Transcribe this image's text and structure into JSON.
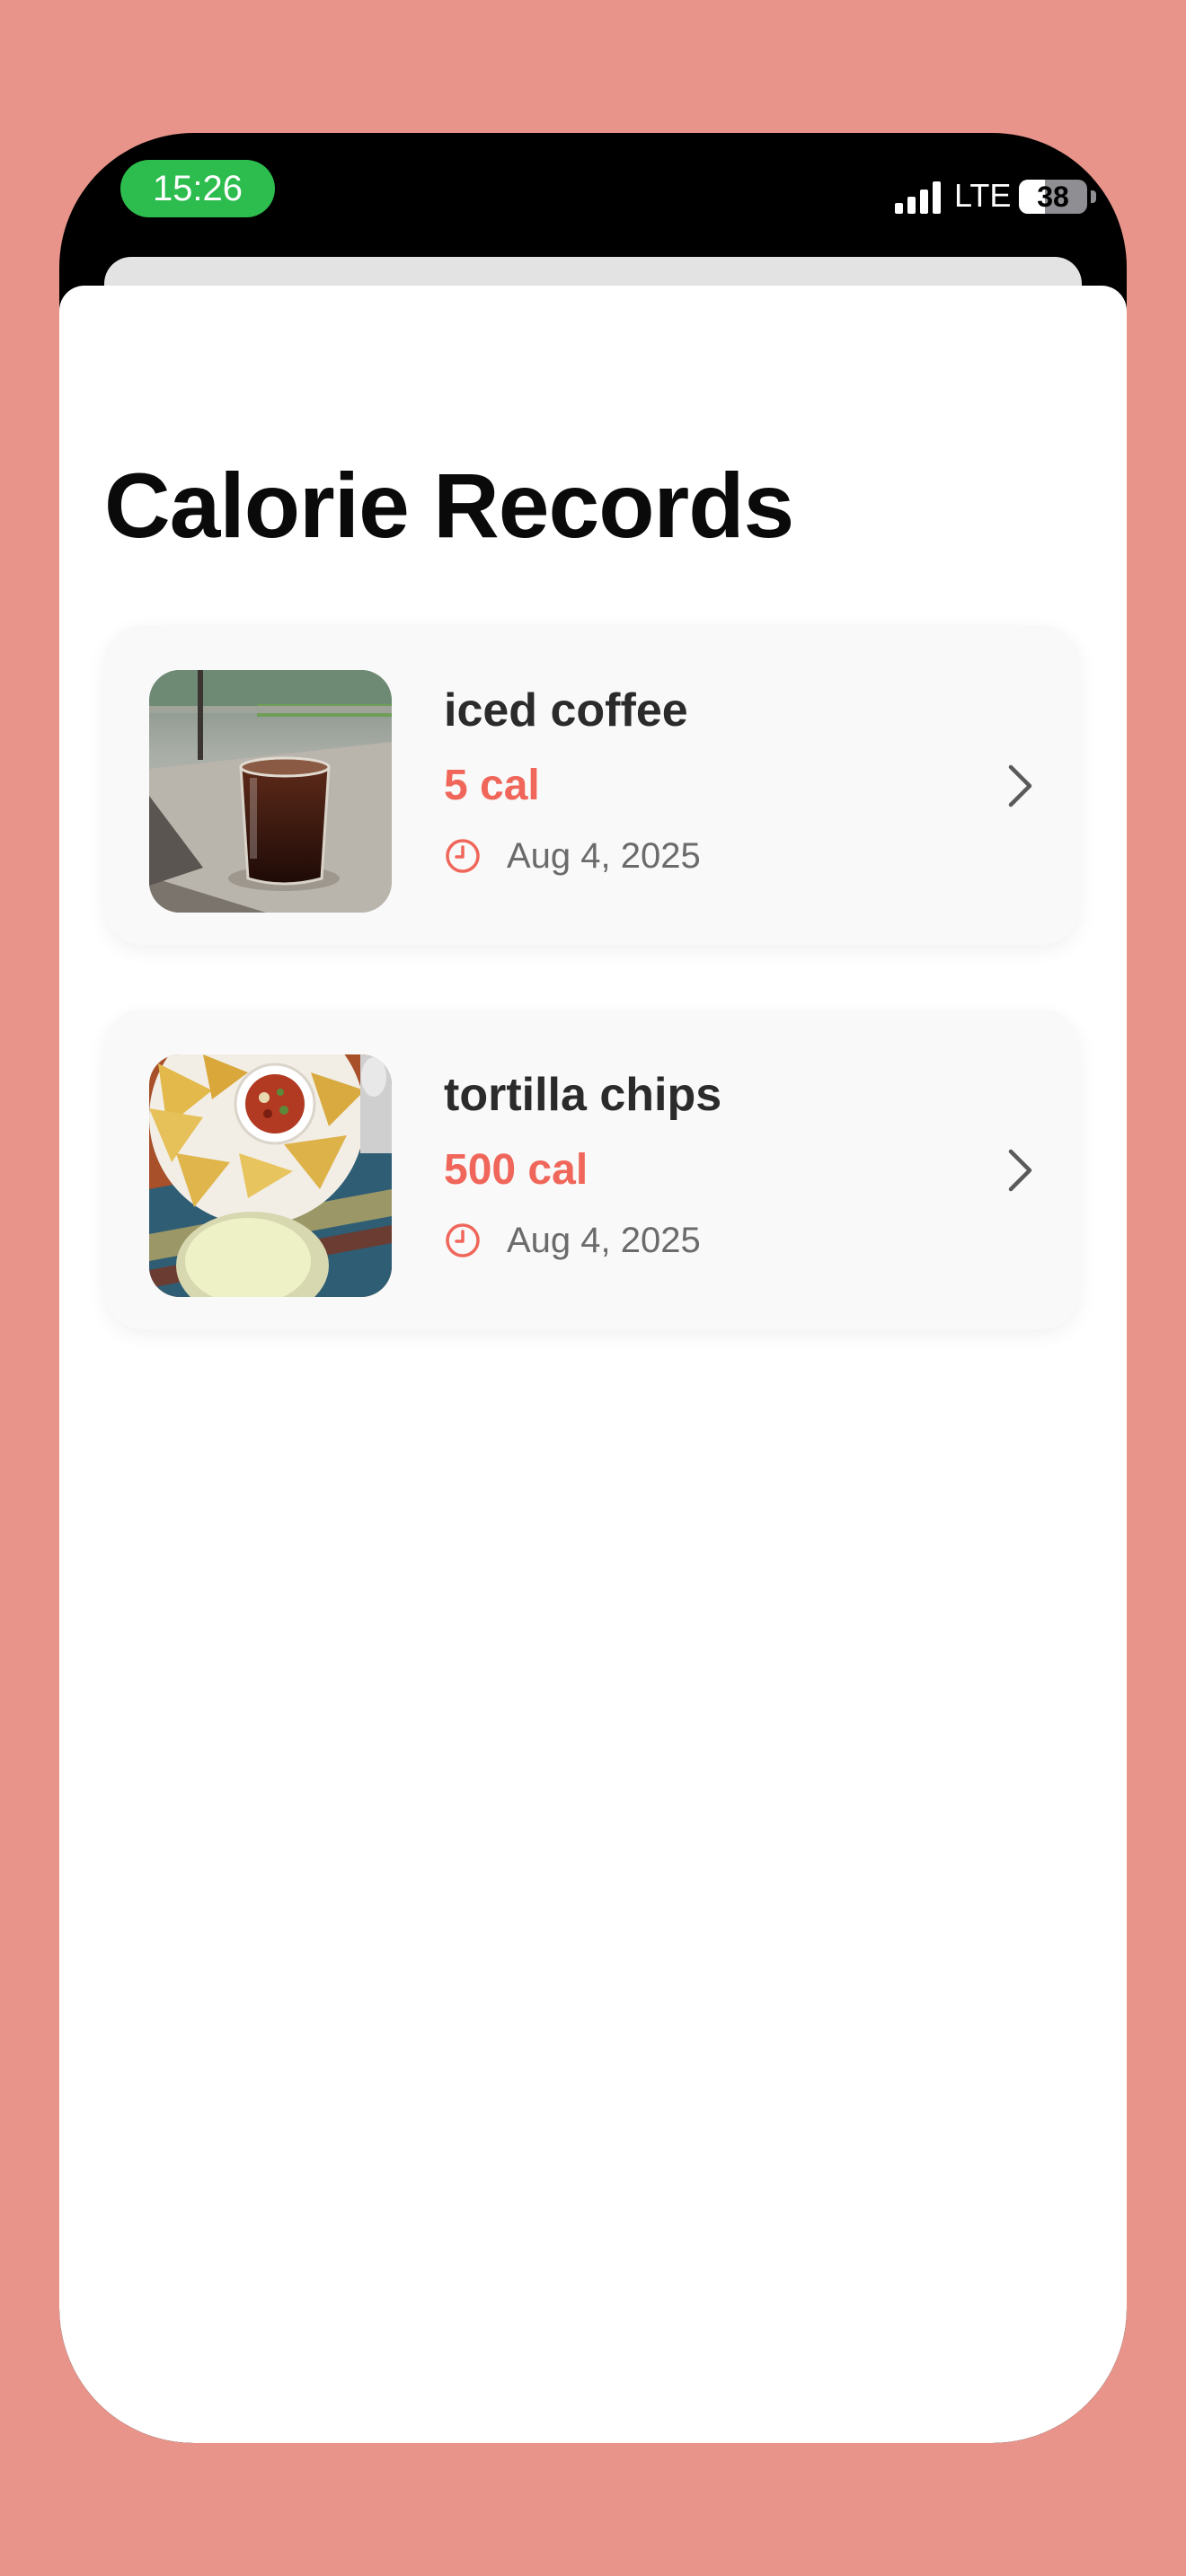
{
  "status_bar": {
    "time": "15:26",
    "network": "LTE",
    "battery_level": "38",
    "battery_fraction": 0.38
  },
  "page": {
    "title": "Calorie Records"
  },
  "records": [
    {
      "name": "iced coffee",
      "calories": "5 cal",
      "date": "Aug 4, 2025",
      "photo": "iced-coffee-photo"
    },
    {
      "name": "tortilla chips",
      "calories": "500 cal",
      "date": "Aug 4, 2025",
      "photo": "tortilla-chips-photo"
    }
  ],
  "colors": {
    "background": "#E8948A",
    "accent": "#F0665A",
    "time_pill": "#2DBD4E",
    "card": "#F8F9F8"
  },
  "icons": {
    "clock": "clock-icon",
    "chevron": "chevron-right-icon",
    "signal": "signal-bars-icon",
    "battery": "battery-icon"
  }
}
